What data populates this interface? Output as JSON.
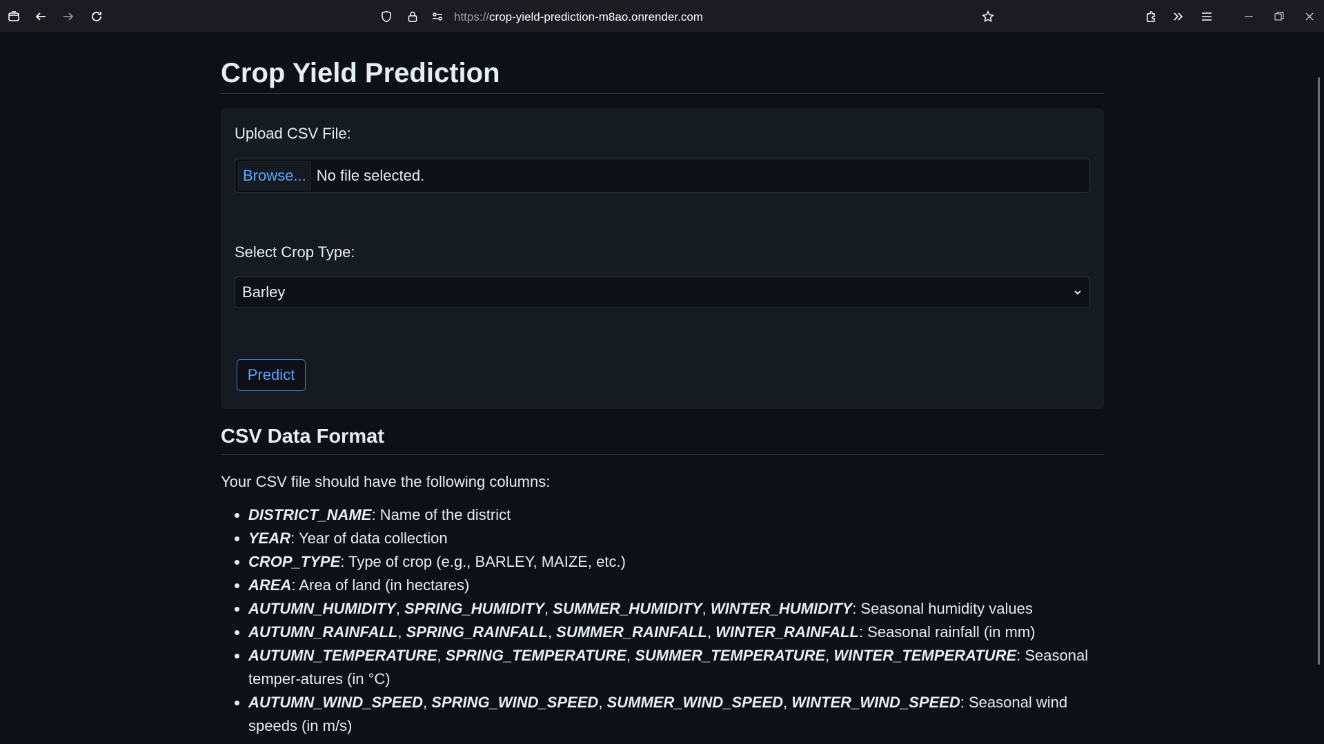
{
  "browser": {
    "url_protocol": "https://",
    "url_host": "crop-yield-prediction-m8ao.onrender.com"
  },
  "page": {
    "title": "Crop Yield Prediction",
    "upload_label": "Upload CSV File:",
    "browse_label": "Browse...",
    "file_status": "No file selected.",
    "crop_label": "Select Crop Type:",
    "crop_selected": "Barley",
    "predict_label": "Predict"
  },
  "format": {
    "title": "CSV Data Format",
    "intro": "Your CSV file should have the following columns:",
    "items": [
      {
        "fields": [
          "DISTRICT_NAME"
        ],
        "desc": ": Name of the district"
      },
      {
        "fields": [
          "YEAR"
        ],
        "desc": ": Year of data collection"
      },
      {
        "fields": [
          "CROP_TYPE"
        ],
        "desc": ": Type of crop (e.g., BARLEY, MAIZE, etc.)"
      },
      {
        "fields": [
          "AREA"
        ],
        "desc": ": Area of land (in hectares)"
      },
      {
        "fields": [
          "AUTUMN_HUMIDITY",
          "SPRING_HUMIDITY",
          "SUMMER_HUMIDITY",
          "WINTER_HUMIDITY"
        ],
        "desc": ": Seasonal humidity values"
      },
      {
        "fields": [
          "AUTUMN_RAINFALL",
          "SPRING_RAINFALL",
          "SUMMER_RAINFALL",
          "WINTER_RAINFALL"
        ],
        "desc": ": Seasonal rainfall (in mm)"
      },
      {
        "fields": [
          "AUTUMN_TEMPERATURE",
          "SPRING_TEMPERATURE",
          "SUMMER_TEMPERATURE",
          "WINTER_TEMPERATURE"
        ],
        "desc": ": Seasonal temper-atures (in °C)"
      },
      {
        "fields": [
          "AUTUMN_WIND_SPEED",
          "SPRING_WIND_SPEED",
          "SUMMER_WIND_SPEED",
          "WINTER_WIND_SPEED"
        ],
        "desc": ": Seasonal wind speeds (in m/s)"
      }
    ]
  },
  "colors": {
    "background": "#0d1117",
    "panel": "#161b22",
    "accent": "#58a6ff"
  }
}
